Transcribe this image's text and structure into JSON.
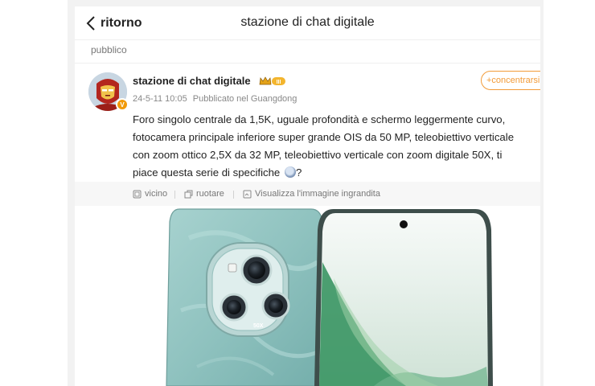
{
  "nav": {
    "back_label": "ritorno",
    "title": "stazione di chat digitale"
  },
  "visibility": "pubblico",
  "post": {
    "author": "stazione di chat digitale",
    "badge_level": "III",
    "verified_mark": "V",
    "date": "24-5-11 10:05",
    "location": "Pubblicato nel Guangdong",
    "follow_label": "+concentrarsi s",
    "text": "Foro singolo centrale da 1,5K, uguale profondità e schermo leggermente curvo, fotocamera principale inferiore super grande OIS da 50 MP, teleobiettivo verticale con zoom ottico 2,5X da 32 MP, teleobiettivo verticale con zoom digitale 50X, ti piace questa serie di specifiche",
    "text_suffix": "?"
  },
  "actions": {
    "nearby": "vicino",
    "rotate": "ruotare",
    "view_large": "Visualizza l'immagine ingrandita"
  },
  "image": {
    "zoom_label": "50X",
    "icon": "phone-photo"
  },
  "colors": {
    "accent": "#f29b38",
    "phone_back": "#8fc2bf",
    "screen_green": "#2f8f5a",
    "badge": "#f19a0a"
  }
}
